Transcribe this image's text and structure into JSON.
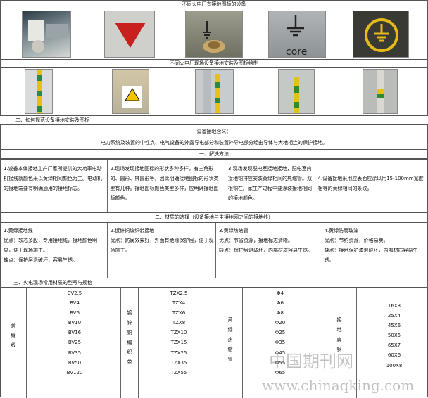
{
  "row1_caption": "不同火电厂有接地图标的设备",
  "row2_caption": "不同火电厂现场设备接地安装及图标绘制",
  "photo_text_core": "core",
  "section2_title": "二、如何规范设备接地安装及图标",
  "definition": {
    "title": "设备接地含义：",
    "text": "电力系统及装置的中性点、电气设备的外露导电部分和装置外导电部分经由导体与大地相连的保护接地。"
  },
  "solutions": {
    "title": "一、解决方法",
    "items": [
      "1.设备本体接地主产厂家所提供的大功率电动机接线就颜色采以黄绿相间颜色为主。电动机的接地端要有明确通用的接地标志。",
      "2.现场发现接地图标的形状多种多样，有三角形的、圆形、椭圆形等。因此明确接地图标的形状类型有几种。接地图标颜色类型多样，应明确接地图标颜色。",
      "3.现场发现配电室接地接地，配电室内接地铜排应安装黄绿相间的热缩管。双根铜在厂家生产过程中要涂装接地相同的接地颜色。",
      "4.设备接地采用应表面应涂以用15-100mm宽度相等的黄绿相间的条纹。"
    ]
  },
  "materials": {
    "title": "二、材质的选择（设备接地与主接地网之间的接地线）",
    "items": [
      {
        "name": "1.黄绿接地线",
        "pros": "优点：软芯多股，专用接地线，接地颜色明显，便于现场施工。",
        "cons": "缺点：保护层退破坏，容易生锈。"
      },
      {
        "name": "2.镀锌铜编织带接地",
        "pros": "优点：防腐效果好，外面有绝缘保护层，便于现场施工。",
        "cons": ""
      },
      {
        "name": "3.黄绿热缩管",
        "pros": "优点：节省资源，接地标志清晰。",
        "cons": "缺点：保护层退破坏，内部材质容易生锈。"
      },
      {
        "name": "4.黄绿防腐玻漆",
        "pros": "优点：节约资源，价格易卖。",
        "cons": "缺点：接地保护漆退破坏，内部材质容易生锈。"
      }
    ]
  },
  "specs": {
    "title": "三、火电现场常用材质的型号与规格",
    "col1_label": "黄绿线",
    "col1_values": [
      "BV2.5",
      "BV4",
      "BV6",
      "BV10",
      "BV16",
      "BV25",
      "BV35",
      "BV50",
      "BV120"
    ],
    "col2_label": "镀锌铜编织带",
    "col2_values": [
      "TZX2.5",
      "TZX4",
      "TZX6",
      "TZX8",
      "TZX10",
      "TZX15",
      "TZX25",
      "TZX35",
      "TZX55"
    ],
    "col3_label": "黄绿热缩管",
    "col3_values": [
      "Φ4",
      "Φ6",
      "Φ8",
      "Φ20",
      "Φ25",
      "Φ35",
      "Φ45",
      "Φ55",
      "Φ65"
    ],
    "col4_label": "接地扁钢",
    "col4_values": [
      "16X3",
      "25X4",
      "45X6",
      "50X5",
      "65X7",
      "60X6",
      "100X8"
    ]
  },
  "watermark": {
    "cn": "中国期刊网",
    "url": "www.chinaqking.com"
  }
}
